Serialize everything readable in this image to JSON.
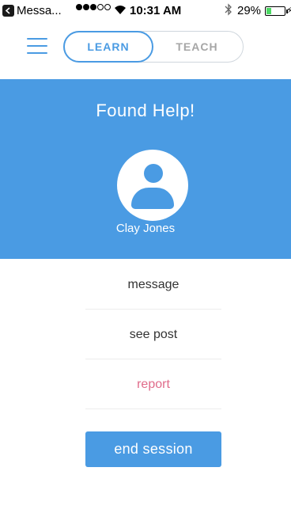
{
  "status_bar": {
    "back_app": "Messa...",
    "time": "10:31 AM",
    "battery_percent": "29%",
    "battery_level": 0.29,
    "signal_bars_filled": 3,
    "signal_bars_total": 5
  },
  "nav": {
    "tabs": [
      {
        "label": "LEARN",
        "active": true
      },
      {
        "label": "TEACH",
        "active": false
      }
    ]
  },
  "hero": {
    "title": "Found Help!",
    "user_name": "Clay Jones",
    "avatar_icon": "person-icon"
  },
  "options": [
    {
      "label": "message"
    },
    {
      "label": "see post"
    },
    {
      "label": "report"
    }
  ],
  "end_button": {
    "label": "end session"
  },
  "colors": {
    "accent": "#4a9be3",
    "report": "#e06b8a",
    "inactive_tab": "#a6a6a6"
  }
}
